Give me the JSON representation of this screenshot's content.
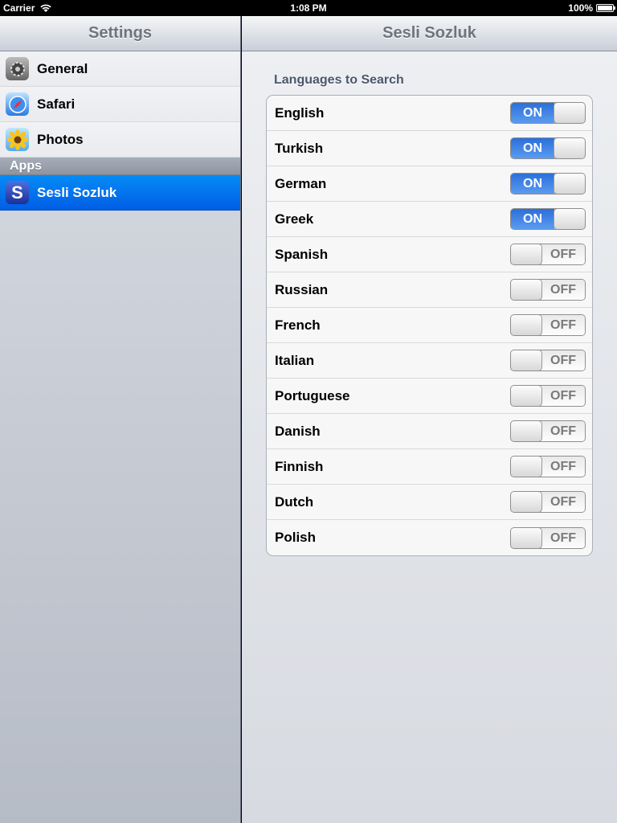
{
  "status_bar": {
    "carrier": "Carrier",
    "time": "1:08 PM",
    "battery": "100%"
  },
  "master": {
    "title": "Settings",
    "items": [
      {
        "label": "General",
        "icon": "gear-icon"
      },
      {
        "label": "Safari",
        "icon": "compass-icon"
      },
      {
        "label": "Photos",
        "icon": "sunflower-icon"
      }
    ],
    "apps_header": "Apps",
    "apps": [
      {
        "label": "Sesli Sozluk",
        "icon_letter": "S",
        "selected": true
      }
    ]
  },
  "detail": {
    "title": "Sesli Sozluk",
    "group_header": "Languages to Search",
    "languages": [
      {
        "name": "English",
        "state": "ON",
        "on": true
      },
      {
        "name": "Turkish",
        "state": "ON",
        "on": true
      },
      {
        "name": "German",
        "state": "ON",
        "on": true
      },
      {
        "name": "Greek",
        "state": "ON",
        "on": true
      },
      {
        "name": "Spanish",
        "state": "OFF",
        "on": false
      },
      {
        "name": "Russian",
        "state": "OFF",
        "on": false
      },
      {
        "name": "French",
        "state": "OFF",
        "on": false
      },
      {
        "name": "Italian",
        "state": "OFF",
        "on": false
      },
      {
        "name": "Portuguese",
        "state": "OFF",
        "on": false
      },
      {
        "name": "Danish",
        "state": "OFF",
        "on": false
      },
      {
        "name": "Finnish",
        "state": "OFF",
        "on": false
      },
      {
        "name": "Dutch",
        "state": "OFF",
        "on": false
      },
      {
        "name": "Polish",
        "state": "OFF",
        "on": false
      }
    ]
  },
  "colors": {
    "selection_blue": "#0a6cf0",
    "switch_on_blue": "#3a7ee6"
  }
}
